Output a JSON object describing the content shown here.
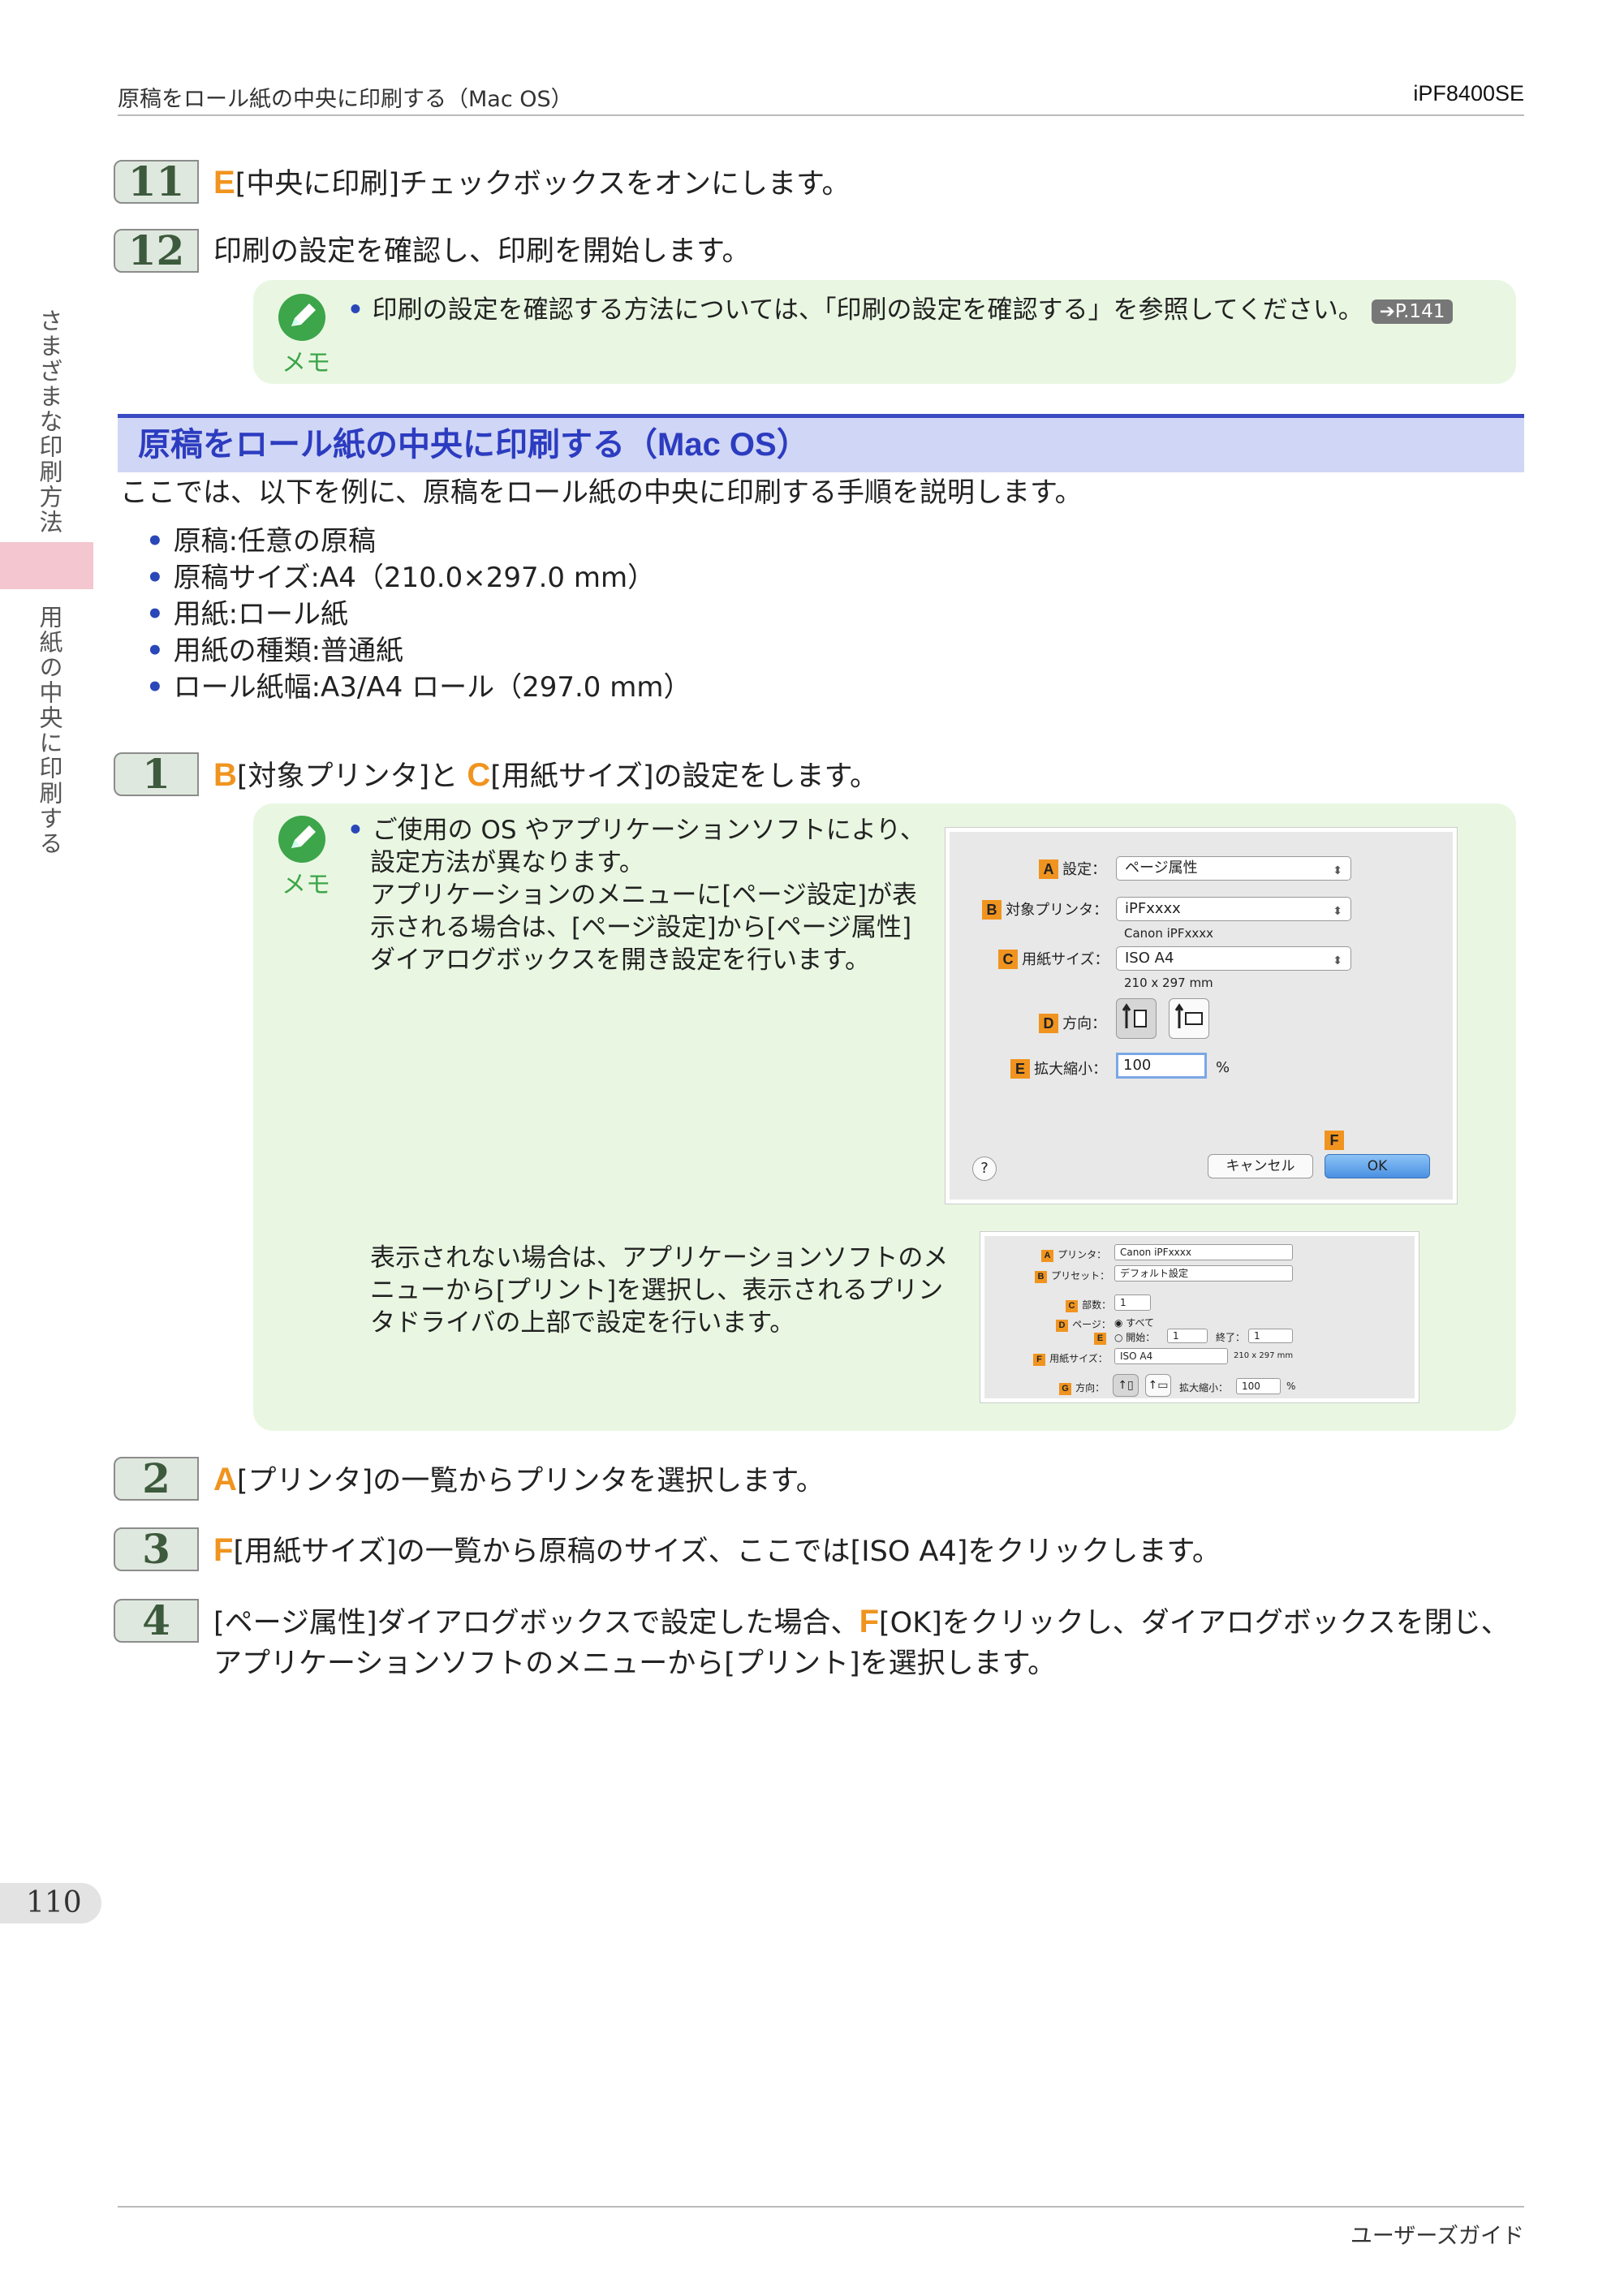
{
  "header": {
    "title": "原稿をロール紙の中央に印刷する（Mac OS）",
    "model": "iPF8400SE"
  },
  "side": {
    "tab1": "さまざまな印刷方法",
    "tab2": "用紙の中央に印刷する"
  },
  "steps_top": [
    {
      "num": "11",
      "key": "E",
      "text": "[中央に印刷]チェックボックスをオンにします。"
    },
    {
      "num": "12",
      "key": "",
      "text": "印刷の設定を確認し、印刷を開始します。"
    }
  ],
  "memo1": {
    "label": "メモ",
    "text": "印刷の設定を確認する方法については、「印刷の設定を確認する」を参照してください。",
    "ref": "➔P.141"
  },
  "section": {
    "title": "原稿をロール紙の中央に印刷する（Mac OS）",
    "intro": "ここでは、以下を例に、原稿をロール紙の中央に印刷する手順を説明します。",
    "items": [
      "原稿:任意の原稿",
      "原稿サイズ:A4（210.0×297.0 mm）",
      "用紙:ロール紙",
      "用紙の種類:普通紙",
      "ロール紙幅:A3/A4 ロール（297.0 mm）"
    ]
  },
  "step1": {
    "num": "1",
    "key1": "B",
    "mid": "[対象プリンタ]と",
    "key2": "C",
    "text": "[用紙サイズ]の設定をします。"
  },
  "memo2": {
    "label": "メモ",
    "text1": "ご使用の OS やアプリケーションソフトにより、設定方法が異なります。",
    "text2": "アプリケーションのメニューに[ページ設定]が表示される場合は、[ページ設定]から[ページ属性]ダイアログボックスを開き設定を行います。",
    "text3": "表示されない場合は、アプリケーションソフトのメニューから[プリント]を選択し、表示されるプリンタドライバの上部で設定を行います。"
  },
  "dialog1": {
    "tags": {
      "a": "A",
      "b": "B",
      "c": "C",
      "d": "D",
      "e": "E",
      "f": "F"
    },
    "setting_label": "設定：",
    "setting_value": "ページ属性",
    "printer_label": "対象プリンタ：",
    "printer_value": "iPFxxxx",
    "printer_sub": "Canon iPFxxxx",
    "paper_label": "用紙サイズ：",
    "paper_value": "ISO A4",
    "paper_sub": "210 x 297 mm",
    "orient_label": "方向：",
    "scale_label": "拡大縮小：",
    "scale_value": "100",
    "scale_unit": "%",
    "help": "?",
    "cancel": "キャンセル",
    "ok": "OK"
  },
  "dialog2": {
    "tags": {
      "a": "A",
      "b": "B",
      "c": "C",
      "d": "D",
      "e": "E",
      "f": "F",
      "g": "G"
    },
    "printer_label": "プリンタ：",
    "printer_value": "Canon iPFxxxx",
    "preset_label": "プリセット：",
    "preset_value": "デフォルト設定",
    "copies_label": "部数：",
    "copies_value": "1",
    "pages_label": "ページ：",
    "pages_all": "すべて",
    "from_label": "開始：",
    "from_value": "1",
    "to_label": "終了：",
    "to_value": "1",
    "paper_label": "用紙サイズ：",
    "paper_value": "ISO A4",
    "paper_sub": "210 x 297 mm",
    "orient_label": "方向：",
    "scale_label": "拡大縮小：",
    "scale_value": "100",
    "scale_unit": "%"
  },
  "steps_bottom": [
    {
      "num": "2",
      "key": "A",
      "text": "[プリンタ]の一覧からプリンタを選択します。"
    },
    {
      "num": "3",
      "key": "F",
      "text": "[用紙サイズ]の一覧から原稿のサイズ、ここでは[ISO A4]をクリックします。"
    },
    {
      "num": "4",
      "key": "F",
      "pre": "[ページ属性]ダイアログボックスで設定した場合、",
      "text": "[OK]をクリックし、ダイアログボックスを閉じ、アプリケーションソフトのメニューから[プリント]を選択します。"
    }
  ],
  "footer": {
    "page": "110",
    "guide": "ユーザーズガイド"
  }
}
